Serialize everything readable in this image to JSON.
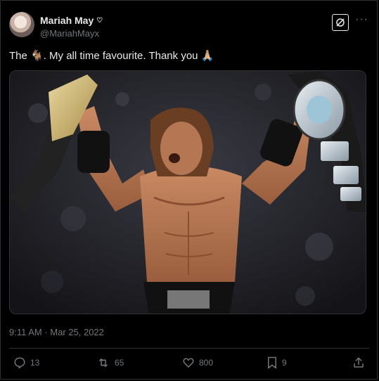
{
  "author": {
    "display_name": "Mariah May",
    "name_badge_icon": "heart-outline-icon",
    "handle": "@MariahMayx"
  },
  "header_icons": {
    "logo": "x-logo-icon",
    "more": "more-horizontal-icon",
    "more_glyph": "···"
  },
  "tweet": {
    "text": "The 🐐. My all time favourite. Thank you 🙏🏼",
    "timestamp": "9:11 AM · Mar 25, 2022"
  },
  "media": {
    "description_icon": "wrestler-photo-image"
  },
  "actions": {
    "replies": "13",
    "reposts": "65",
    "likes": "800",
    "bookmarks": "9"
  },
  "colors": {
    "background": "#000000",
    "text_primary": "#e7e9ea",
    "text_secondary": "#71767b",
    "divider": "#2f3336"
  }
}
